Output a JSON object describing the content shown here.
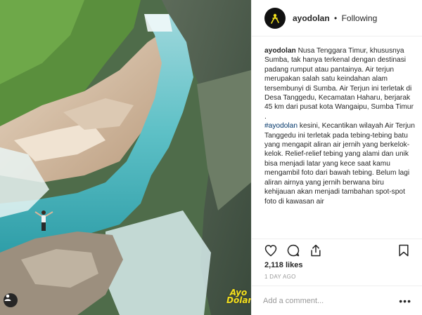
{
  "post": {
    "username": "ayodolan",
    "separator": "•",
    "follow_status": "Following",
    "caption": {
      "part1": "Nusa Tenggara Timur, khususnya Sumba, tak hanya terkenal dengan destinasi padang rumput atau pantainya. Air terjun merupakan salah satu keindahan alam tersembunyi di Sumba. Air Terjun ini terletak di Desa Tanggedu, Kecamatan Haharu, berjarak 45 km dari pusat kota Wangaipu, Sumba Timur",
      "dot_line": ".",
      "hashtag": "#ayodolan",
      "part2": " kesini, Kecantikan wilayah Air Terjun Tanggedu ini terletak pada tebing-tebing batu yang mengapit aliran air jernih yang berkelok-kelok. Relief-relief tebing yang alami dan unik bisa menjadi latar yang kece saat kamu mengambil foto dari bawah tebing. Belum lagi aliran airnya yang jernih berwana biru kehijauan akan menjadi tambahan spot-spot foto di kawasan air"
    },
    "likes": "2,118 likes",
    "timestamp": "1 DAY AGO",
    "comment_placeholder": "Add a comment...",
    "more_label": "•••",
    "watermark": {
      "line1": "Ayo",
      "line2": "Dolan"
    }
  },
  "icons": {
    "like": "heart-icon",
    "comment": "comment-icon",
    "share": "share-icon",
    "save": "bookmark-icon",
    "user_tag": "user-icon"
  },
  "colors": {
    "brand_yellow": "#f2e01c",
    "link_blue": "#003569",
    "text": "#262626",
    "muted": "#999999"
  }
}
